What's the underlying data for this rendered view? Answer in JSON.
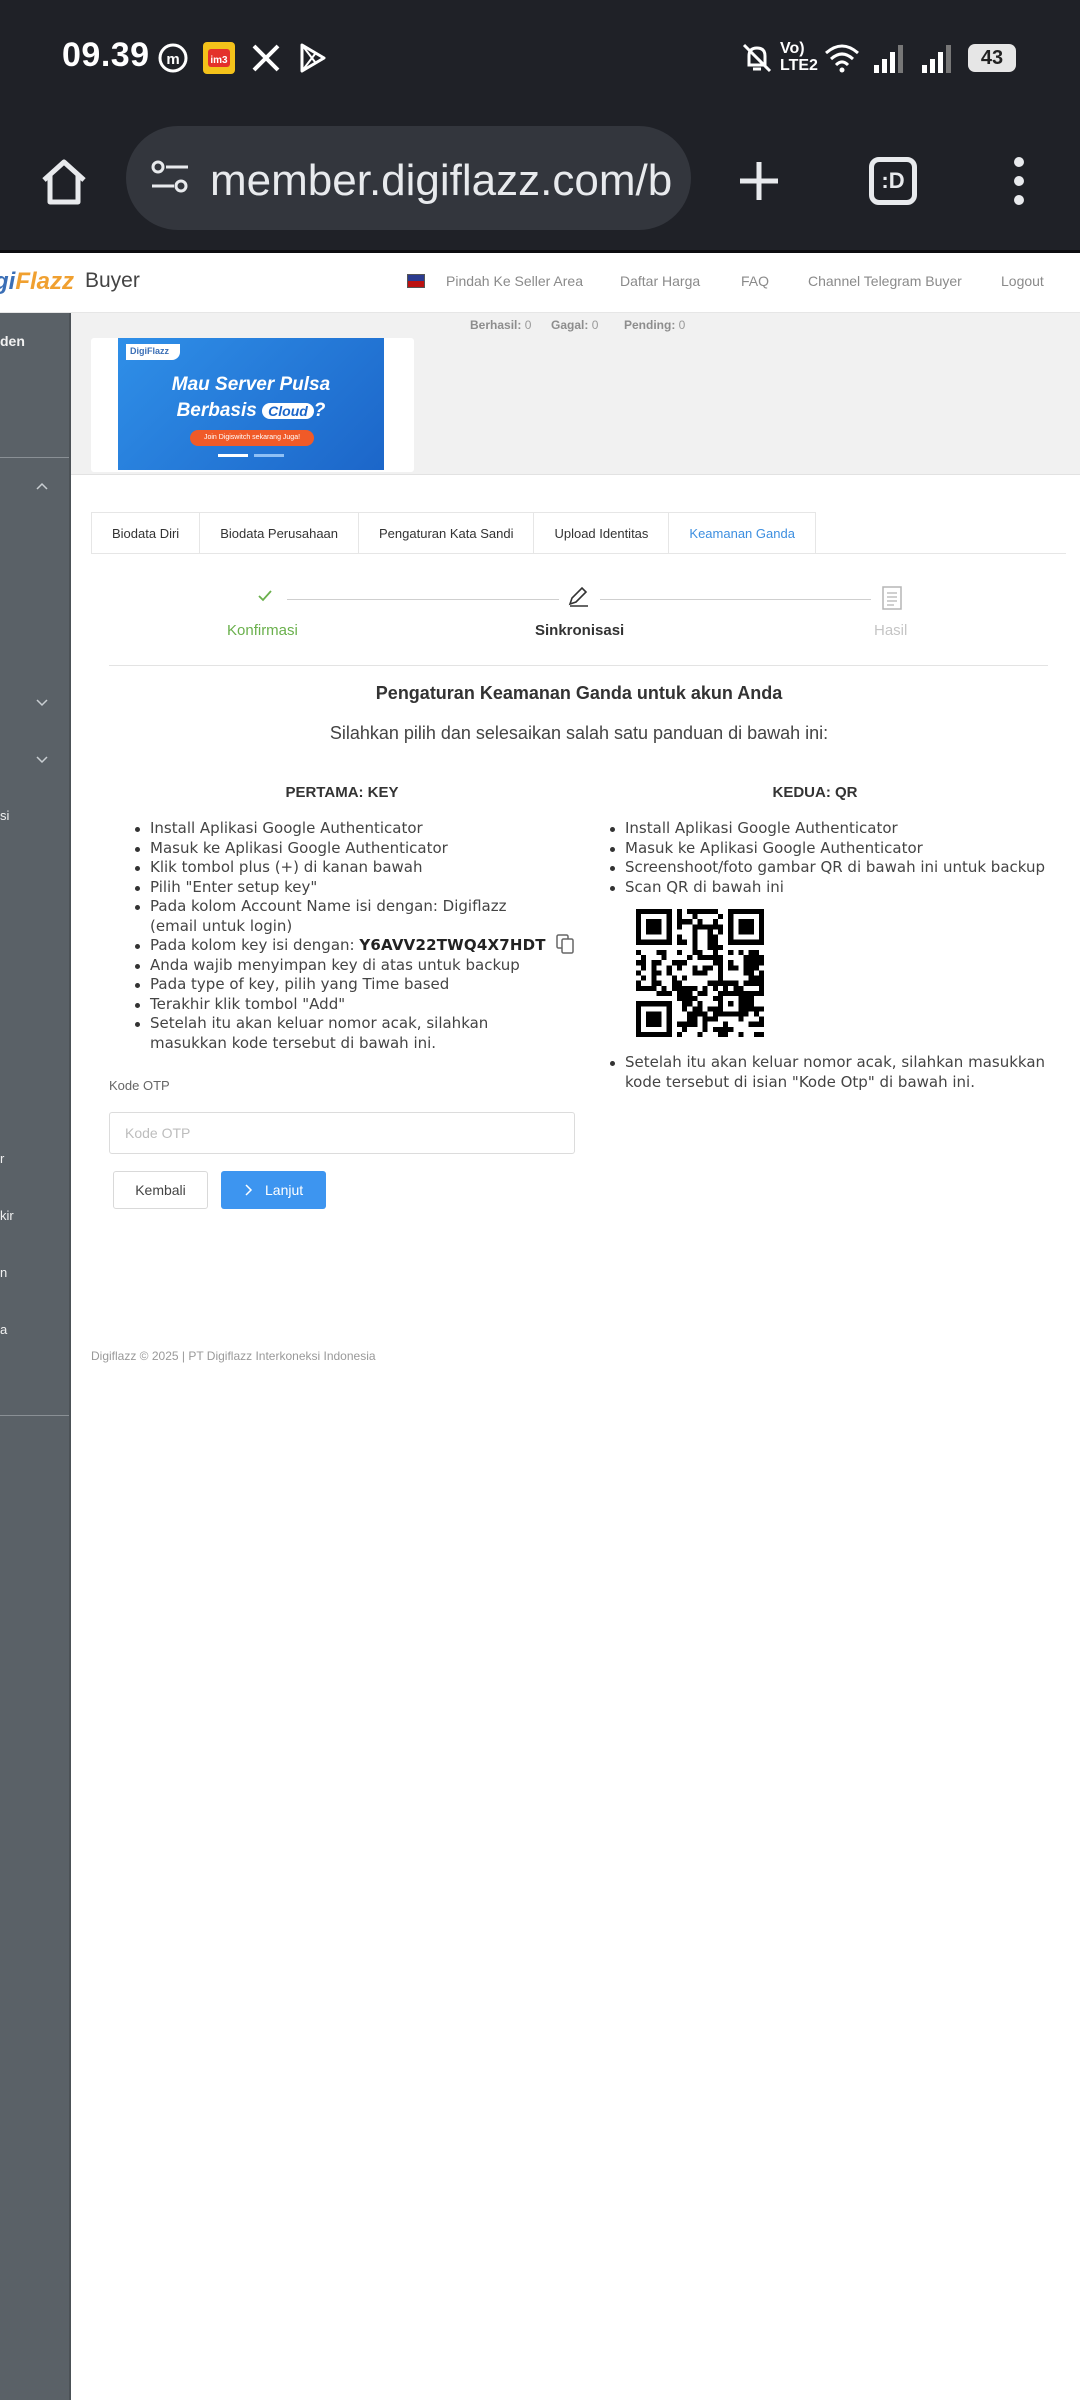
{
  "status_bar": {
    "time": "09.39",
    "network_label": "Vo) LTE2",
    "battery": "43"
  },
  "browser": {
    "url": "member.digiflazz.com/b",
    "tab_count_label": ":D"
  },
  "header": {
    "logo_part1": "gi",
    "logo_part2": "Flazz",
    "logo_suffix": "Buyer",
    "nav": [
      {
        "label": "Pindah Ke Seller Area"
      },
      {
        "label": "Daftar Harga"
      },
      {
        "label": "FAQ"
      },
      {
        "label": "Channel Telegram Buyer"
      },
      {
        "label": "Logout"
      }
    ]
  },
  "sidebar": {
    "items": [
      {
        "label": "den"
      },
      {
        "label": "si"
      },
      {
        "label": "r"
      },
      {
        "label": "kir"
      },
      {
        "label": "n"
      },
      {
        "label": "a"
      }
    ]
  },
  "stats": {
    "berhasil_label": "Berhasil:",
    "berhasil_value": "0",
    "gagal_label": "Gagal:",
    "gagal_value": "0",
    "pending_label": "Pending:",
    "pending_value": "0"
  },
  "banner": {
    "brand": "DigiFlazz",
    "line1": "Mau Server Pulsa",
    "line2": "Berbasis",
    "cloud": "Cloud",
    "question": "?",
    "cta": "Join Digiswitch sekarang Juga!"
  },
  "tabs": [
    {
      "label": "Biodata Diri"
    },
    {
      "label": "Biodata Perusahaan"
    },
    {
      "label": "Pengaturan Kata Sandi"
    },
    {
      "label": "Upload Identitas"
    },
    {
      "label": "Keamanan Ganda"
    }
  ],
  "steps": [
    {
      "label": "Konfirmasi",
      "status": "done"
    },
    {
      "label": "Sinkronisasi",
      "status": "current"
    },
    {
      "label": "Hasil",
      "status": "pending"
    }
  ],
  "main": {
    "heading": "Pengaturan Keamanan Ganda untuk akun Anda",
    "subheading": "Silahkan pilih dan selesaikan salah satu panduan di bawah ini:",
    "key_title": "PERTAMA: KEY",
    "qr_title": "KEDUA: QR",
    "key_steps": [
      "Install Aplikasi Google Authenticator",
      "Masuk ke Aplikasi Google Authenticator",
      "Klik tombol plus (+) di kanan bawah",
      "Pilih \"Enter setup key\"",
      "Pada kolom Account Name isi dengan: Digiflazz (email untuk login)",
      "Pada kolom key isi dengan: ",
      "Anda wajib menyimpan key di atas untuk backup",
      "Pada type of key, pilih yang Time based",
      "Terakhir klik tombol \"Add\"",
      "Setelah itu akan keluar nomor acak, silahkan masukkan kode tersebut di bawah ini."
    ],
    "secret_key": "Y6AVV22TWQ4X7HDT",
    "qr_steps": [
      "Install Aplikasi Google Authenticator",
      "Masuk ke Aplikasi Google Authenticator",
      "Screenshoot/foto gambar QR di bawah ini untuk backup",
      "Scan QR di bawah ini"
    ],
    "qr_after": "Setelah itu akan keluar nomor acak, silahkan masukkan kode tersebut di isian \"Kode Otp\" di bawah ini.",
    "otp_label": "Kode OTP",
    "otp_placeholder": "Kode OTP",
    "otp_value": "",
    "back_label": "Kembali",
    "next_label": "Lanjut"
  },
  "footer": {
    "text": "Digiflazz © 2025 | PT Digiflazz Interkoneksi Indonesia"
  },
  "colors": {
    "accent": "#3d95f0",
    "success": "#6ab04c",
    "sidebar": "#5a6167",
    "chrome": "#1f2127"
  }
}
